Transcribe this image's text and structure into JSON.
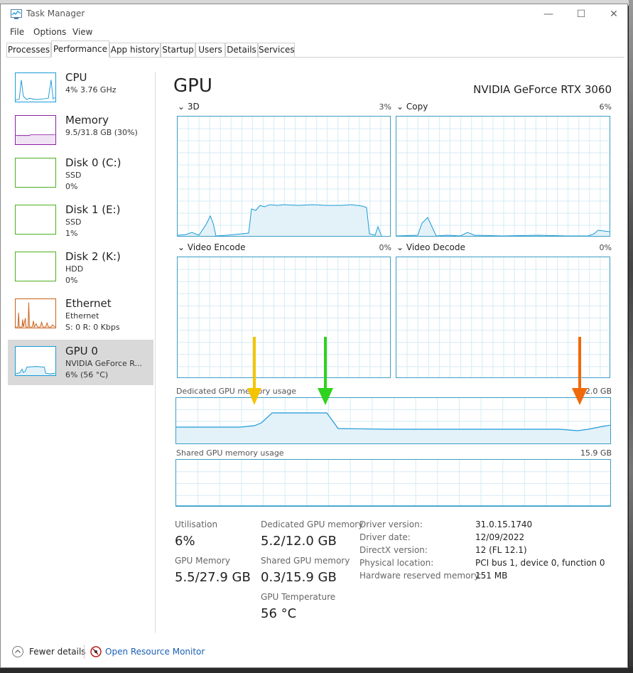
{
  "background": {
    "top_text": "... _ ... ... ..."
  },
  "window": {
    "title": "Task Manager",
    "minimize": "—",
    "maximize": "☐",
    "close": "✕"
  },
  "menu": [
    "File",
    "Options",
    "View"
  ],
  "tabs": [
    "Processes",
    "Performance",
    "App history",
    "Startup",
    "Users",
    "Details",
    "Services"
  ],
  "active_tab": "Performance",
  "sidebar": [
    {
      "name": "CPU",
      "sub1": "4% 3.76 GHz",
      "sub2": "",
      "color": "#1a9bd7"
    },
    {
      "name": "Memory",
      "sub1": "9.5/31.8 GB (30%)",
      "sub2": "",
      "color": "#8b1ea3"
    },
    {
      "name": "Disk 0 (C:)",
      "sub1": "SSD",
      "sub2": "0%",
      "color": "#4cae1f"
    },
    {
      "name": "Disk 1 (E:)",
      "sub1": "SSD",
      "sub2": "1%",
      "color": "#4cae1f"
    },
    {
      "name": "Disk 2 (K:)",
      "sub1": "HDD",
      "sub2": "0%",
      "color": "#4cae1f"
    },
    {
      "name": "Ethernet",
      "sub1": "Ethernet",
      "sub2": "S: 0  R: 0 Kbps",
      "color": "#c9601b"
    },
    {
      "name": "GPU 0",
      "sub1": "NVIDIA GeForce R...",
      "sub2": "6% (56 °C)",
      "color": "#1a9bd7"
    }
  ],
  "gpu": {
    "title": "GPU",
    "model": "NVIDIA GeForce RTX 3060",
    "engines": [
      {
        "label": "3D",
        "pct": "3%"
      },
      {
        "label": "Copy",
        "pct": "6%"
      },
      {
        "label": "Video Encode",
        "pct": "0%"
      },
      {
        "label": "Video Decode",
        "pct": "0%"
      }
    ],
    "dedicated_label": "Dedicated GPU memory usage",
    "dedicated_max": "12.0 GB",
    "shared_label": "Shared GPU memory usage",
    "shared_max": "15.9 GB"
  },
  "stats": {
    "utilisation_label": "Utilisation",
    "utilisation": "6%",
    "gpu_memory_label": "GPU Memory",
    "gpu_memory": "5.5/27.9 GB",
    "dedicated_label": "Dedicated GPU memory",
    "dedicated": "5.2/12.0 GB",
    "shared_label": "Shared GPU memory",
    "shared": "0.3/15.9 GB",
    "temp_label": "GPU Temperature",
    "temp": "56 °C"
  },
  "properties": [
    {
      "label": "Driver version:",
      "value": "31.0.15.1740"
    },
    {
      "label": "Driver date:",
      "value": "12/09/2022"
    },
    {
      "label": "DirectX version:",
      "value": "12 (FL 12.1)"
    },
    {
      "label": "Physical location:",
      "value": "PCI bus 1, device 0, function 0"
    },
    {
      "label": "Hardware reserved memory:",
      "value": "151 MB"
    }
  ],
  "footer": {
    "fewer_details": "Fewer details",
    "open_resource_monitor": "Open Resource Monitor"
  },
  "colors": {
    "accent": "#1a9bd7",
    "link": "#1a5fb4",
    "arrow_yellow": "#f5c400",
    "arrow_green": "#2fd21e",
    "arrow_orange": "#f06a0a"
  }
}
